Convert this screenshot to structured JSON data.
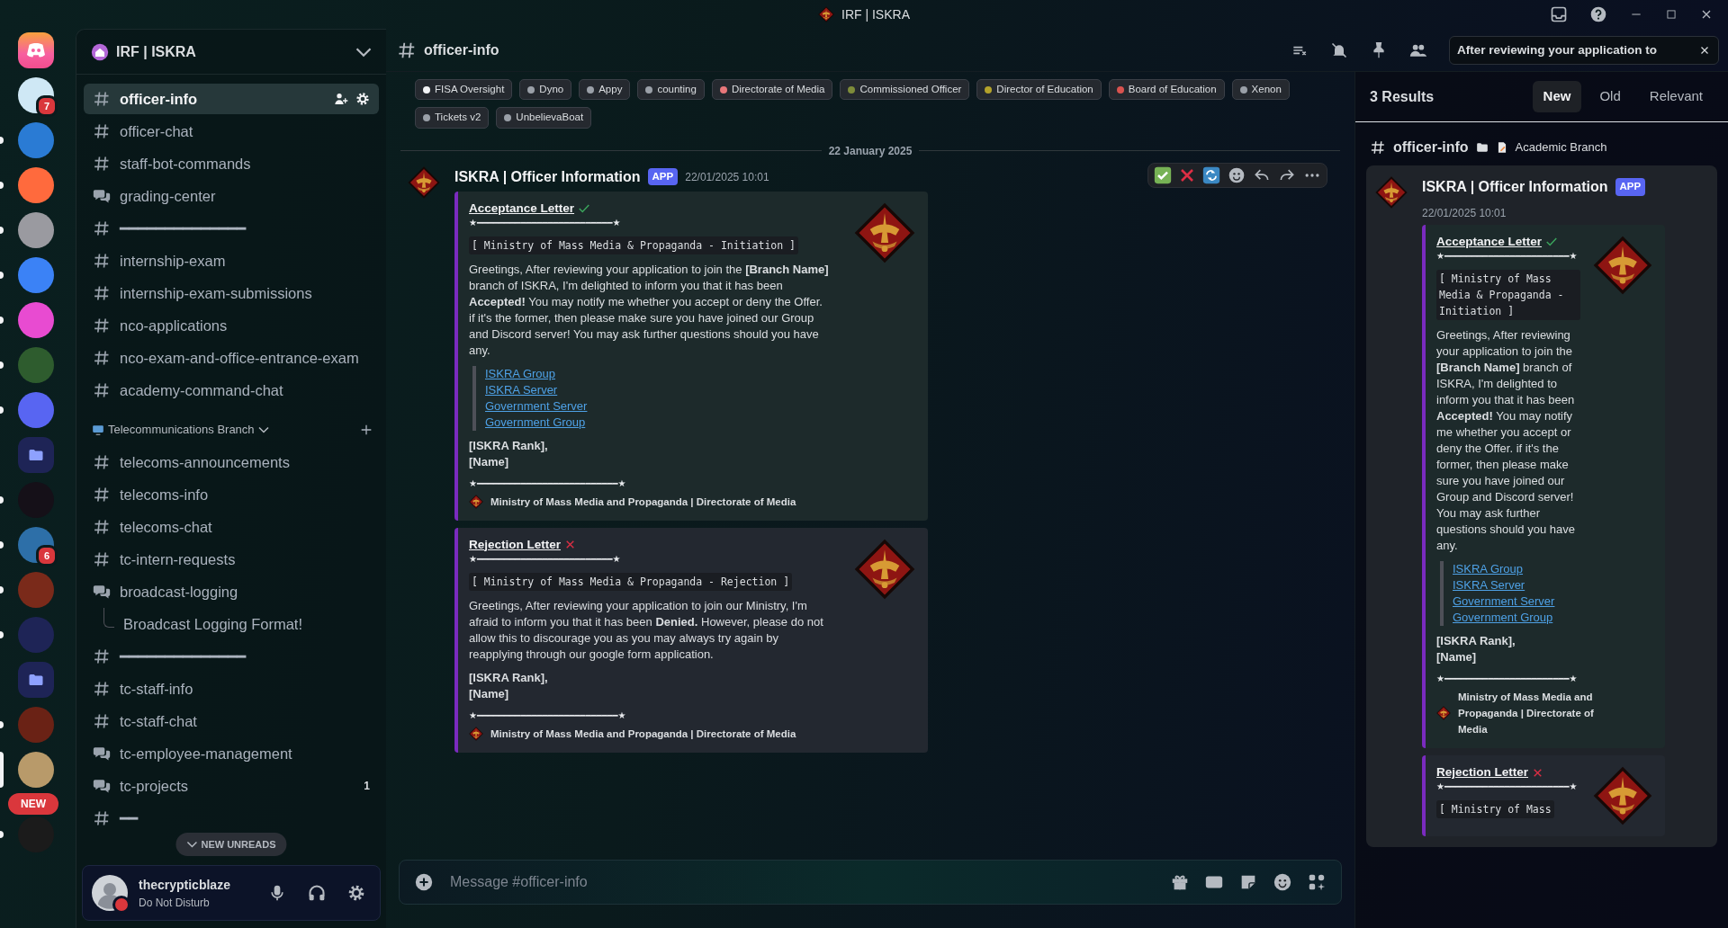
{
  "titlebar": {
    "title": "IRF | ISKRA"
  },
  "servers": [
    {
      "kind": "home",
      "unread": false,
      "selected": false
    },
    {
      "kind": "server",
      "badge": "7",
      "unread": false,
      "selected": false
    },
    {
      "kind": "server",
      "unread": true,
      "selected": false
    },
    {
      "kind": "server",
      "unread": true,
      "selected": false
    },
    {
      "kind": "server",
      "unread": true,
      "selected": false
    },
    {
      "kind": "server",
      "unread": true,
      "selected": false
    },
    {
      "kind": "server",
      "unread": true,
      "selected": false
    },
    {
      "kind": "server",
      "unread": true,
      "selected": false
    },
    {
      "kind": "server",
      "unread": true,
      "selected": false
    },
    {
      "kind": "folder",
      "unread": false,
      "selected": false
    },
    {
      "kind": "server",
      "unread": true,
      "selected": false
    },
    {
      "kind": "server",
      "badge": "6",
      "unread": true,
      "selected": false
    },
    {
      "kind": "server",
      "unread": true,
      "selected": false
    },
    {
      "kind": "server",
      "unread": true,
      "selected": false
    },
    {
      "kind": "folder",
      "unread": false,
      "selected": false
    },
    {
      "kind": "server",
      "unread": true,
      "selected": false
    },
    {
      "kind": "server",
      "unread": false,
      "selected": true
    },
    {
      "kind": "server",
      "unread": true,
      "selected": false
    }
  ],
  "new_pill": "NEW",
  "guild": {
    "name": "IRF | ISKRA"
  },
  "channels": [
    {
      "kind": "text",
      "name": "officer-info",
      "selected": true
    },
    {
      "kind": "text",
      "name": "officer-chat",
      "selected": false
    },
    {
      "kind": "text",
      "name": "staff-bot-commands",
      "selected": false
    },
    {
      "kind": "forum",
      "name": "grading-center",
      "selected": false
    },
    {
      "kind": "text",
      "name": "━━━━━━━━━━━━━━",
      "selected": false
    },
    {
      "kind": "text",
      "name": "internship-exam",
      "selected": false
    },
    {
      "kind": "text",
      "name": "internship-exam-submissions",
      "selected": false
    },
    {
      "kind": "text",
      "name": "nco-applications",
      "selected": false
    },
    {
      "kind": "text",
      "name": "nco-exam-and-office-entrance-exam",
      "selected": false
    },
    {
      "kind": "text",
      "name": "academy-command-chat",
      "selected": false
    },
    {
      "kind": "category",
      "name": "Telecommunications Branch",
      "selected": false
    },
    {
      "kind": "text",
      "name": "telecoms-announcements",
      "selected": false
    },
    {
      "kind": "text",
      "name": "telecoms-info",
      "selected": false
    },
    {
      "kind": "text",
      "name": "telecoms-chat",
      "selected": false
    },
    {
      "kind": "text",
      "name": "tc-intern-requests",
      "selected": false
    },
    {
      "kind": "forum",
      "name": "broadcast-logging",
      "selected": false
    },
    {
      "kind": "thread",
      "name": "Broadcast Logging Format!",
      "selected": false
    },
    {
      "kind": "text",
      "name": "━━━━━━━━━━━━━━",
      "selected": false
    },
    {
      "kind": "text",
      "name": "tc-staff-info",
      "selected": false
    },
    {
      "kind": "text",
      "name": "tc-staff-chat",
      "selected": false
    },
    {
      "kind": "forum",
      "name": "tc-employee-management",
      "selected": false
    },
    {
      "kind": "forum",
      "name": "tc-projects",
      "count": "1",
      "selected": false
    },
    {
      "kind": "text",
      "name": "━━",
      "selected": false
    }
  ],
  "new_unreads": "NEW UNREADS",
  "user": {
    "name": "thecrypticblaze",
    "status": "Do Not Disturb",
    "color": "#da373c"
  },
  "header": {
    "channel": "officer-info",
    "search": "After reviewing your application to"
  },
  "tags": [
    {
      "label": "FISA Oversight",
      "color": "#f2f3f5"
    },
    {
      "label": "Dyno",
      "color": "#9aa0a8"
    },
    {
      "label": "Appy",
      "color": "#9aa0a8"
    },
    {
      "label": "counting",
      "color": "#9aa0a8"
    },
    {
      "label": "Directorate of Media",
      "color": "#e8777a"
    },
    {
      "label": "Commissioned Officer",
      "color": "#7e8c3a"
    },
    {
      "label": "Director of Education",
      "color": "#b3a22b"
    },
    {
      "label": "Board of Education",
      "color": "#d9534f"
    },
    {
      "label": "Xenon",
      "color": "#9aa0a8"
    },
    {
      "label": "Tickets v2",
      "color": "#9aa0a8"
    },
    {
      "label": "UnbelievaBoat",
      "color": "#9aa0a8"
    }
  ],
  "date_divider": "22 January 2025",
  "message": {
    "author": "ISKRA | Officer Information",
    "badge": "APP",
    "time": "22/01/2025 10:01",
    "embeds": [
      {
        "kind": "accept",
        "title": "Acceptance Letter",
        "rule": "★━━━━━━━━━━━━━━━━━━━━━━━━━★",
        "code": "[ Ministry of Mass Media & Propaganda - Initiation ]",
        "body": "Greetings, After reviewing your application to join the **[Branch Name]** branch of ISKRA, I'm delighted to inform you that it has been **Accepted!** You may notify me whether you accept or deny the Offer. if it's the former, then please make sure you have joined our Group and Discord server! You may ask further questions should you have any.",
        "links": [
          "ISKRA Group",
          "ISKRA Server",
          "Government Server",
          "Government Group"
        ],
        "signature": [
          "[ISKRA Rank],",
          "[Name]"
        ],
        "closing_rule": "★━━━━━━━━━━━━━━━━━━━━━━━━━━★",
        "footer": "Ministry of Mass Media and Propaganda | Directorate of Media"
      },
      {
        "kind": "reject",
        "title": "Rejection Letter",
        "rule": "★━━━━━━━━━━━━━━━━━━━━━━━━━★",
        "code": "[ Ministry of Mass Media & Propaganda - Rejection ]",
        "body": "Greetings, After reviewing your application to join our Ministry, I'm afraid to inform you that it has been **Denied.** However, please do not allow this to discourage you as you may always try again by reapplying through our google form application.",
        "signature": [
          "[ISKRA Rank],",
          "[Name]"
        ],
        "closing_rule": "★━━━━━━━━━━━━━━━━━━━━━━━━━━★",
        "footer": "Ministry of Mass Media and Propaganda | Directorate of Media"
      }
    ]
  },
  "composer": {
    "placeholder": "Message #officer-info"
  },
  "search_results": {
    "count": "3 Results",
    "tabs": [
      {
        "label": "New",
        "selected": true
      },
      {
        "label": "Old",
        "selected": false
      },
      {
        "label": "Relevant",
        "selected": false
      }
    ],
    "results": [
      {
        "channel": "officer-info",
        "category": "Academic Branch",
        "message": {
          "author": "ISKRA | Officer Information",
          "badge": "APP",
          "time": "22/01/2025 10:01",
          "embeds": [
            {
              "kind": "accept",
              "title": "Acceptance Letter",
              "rule": "★━━━━━━━━━━━━━━━━━━━━━━━★",
              "code": "[ Ministry of Mass Media & Propaganda - Initiation ]",
              "body": "Greetings, After reviewing your application to join the **[Branch Name]** branch of ISKRA, I'm delighted to inform you that it has been **Accepted!** You may notify me whether you accept or deny the Offer. if it's the former, then please make sure you have joined our Group and Discord server! You may ask further questions should you have any.",
              "links": [
                "ISKRA Group",
                "ISKRA Server",
                "Government Server",
                "Government Group"
              ],
              "signature": [
                "[ISKRA Rank],",
                "[Name]"
              ],
              "closing_rule": "★━━━━━━━━━━━━━━━━━━━━━━━★",
              "footer": "Ministry of Mass Media and Propaganda | Directorate of Media"
            },
            {
              "kind": "reject",
              "title": "Rejection Letter",
              "rule": "★━━━━━━━━━━━━━━━━━━━━━━━★",
              "code": "[ Ministry of Mass"
            }
          ]
        }
      }
    ]
  }
}
